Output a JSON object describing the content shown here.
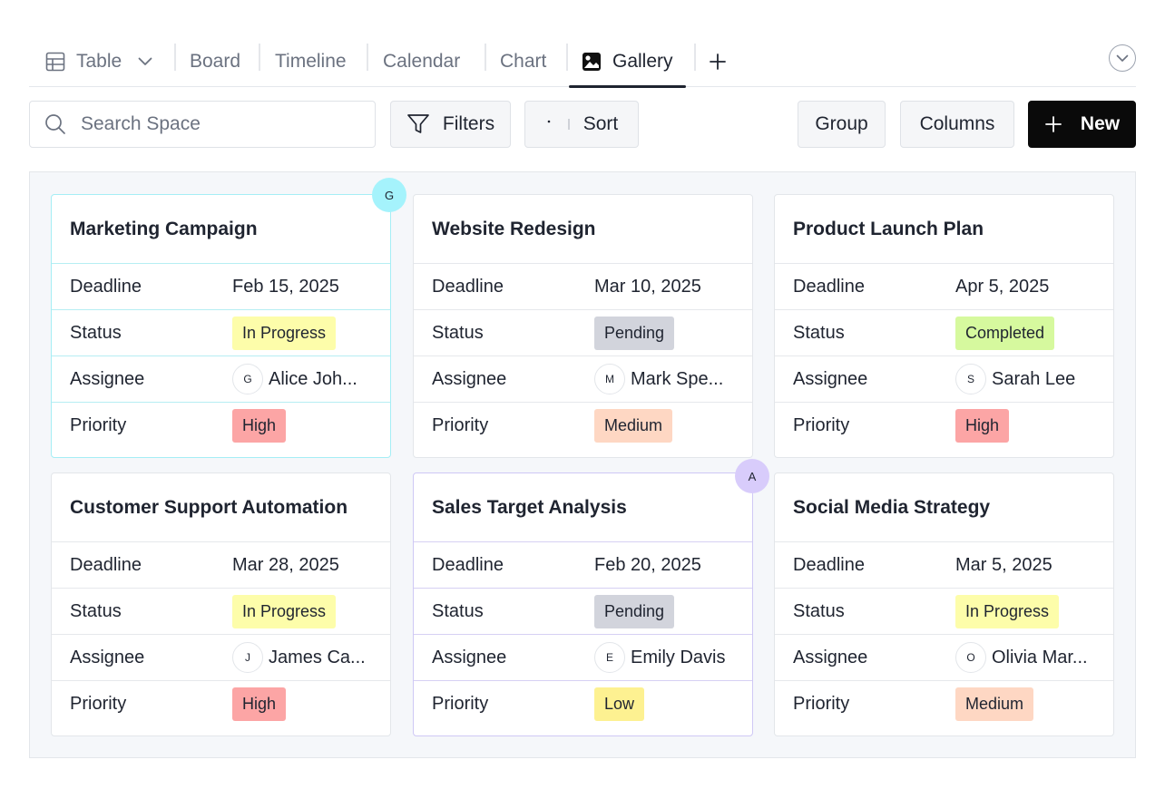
{
  "tabs": [
    {
      "label": "Table",
      "icon": "table-icon",
      "has_dropdown": true,
      "active": false
    },
    {
      "label": "Board",
      "active": false
    },
    {
      "label": "Timeline",
      "active": false
    },
    {
      "label": "Calendar",
      "active": false
    },
    {
      "label": "Chart",
      "active": false
    },
    {
      "label": "Gallery",
      "icon": "image-icon",
      "active": true
    }
  ],
  "toolbar": {
    "search_placeholder": "Search Space",
    "filters_label": "Filters",
    "sort_label": "Sort",
    "group_label": "Group",
    "columns_label": "Columns",
    "new_label": "New"
  },
  "field_labels": {
    "deadline": "Deadline",
    "status": "Status",
    "assignee": "Assignee",
    "priority": "Priority"
  },
  "colors": {
    "in_progress": "#fdfdaa",
    "pending": "#d2d4dc",
    "completed": "#d6f99e",
    "high": "#fca5a5",
    "medium": "#fed7c3",
    "low": "#fdf191",
    "presence_cyan": "#a5f3fc",
    "presence_purple": "#d8ccfb",
    "primary": "#0a0a0a"
  },
  "cards": [
    {
      "title": "Marketing Campaign",
      "deadline": "Feb 15, 2025",
      "status": "In Progress",
      "assignee_initial": "G",
      "assignee": "Alice Joh...",
      "priority": "High",
      "presence": "G"
    },
    {
      "title": "Website Redesign",
      "deadline": "Mar 10, 2025",
      "status": "Pending",
      "assignee_initial": "M",
      "assignee": "Mark Spe...",
      "priority": "Medium"
    },
    {
      "title": "Product Launch Plan",
      "deadline": "Apr 5, 2025",
      "status": "Completed",
      "assignee_initial": "S",
      "assignee": "Sarah Lee",
      "priority": "High"
    },
    {
      "title": "Customer Support Automation",
      "deadline": "Mar 28, 2025",
      "status": "In Progress",
      "assignee_initial": "J",
      "assignee": "James Ca...",
      "priority": "High"
    },
    {
      "title": "Sales Target Analysis",
      "deadline": "Feb 20, 2025",
      "status": "Pending",
      "assignee_initial": "E",
      "assignee": "Emily Davis",
      "priority": "Low",
      "presence": "A"
    },
    {
      "title": "Social Media Strategy",
      "deadline": "Mar 5, 2025",
      "status": "In Progress",
      "assignee_initial": "O",
      "assignee": "Olivia Mar...",
      "priority": "Medium"
    }
  ]
}
